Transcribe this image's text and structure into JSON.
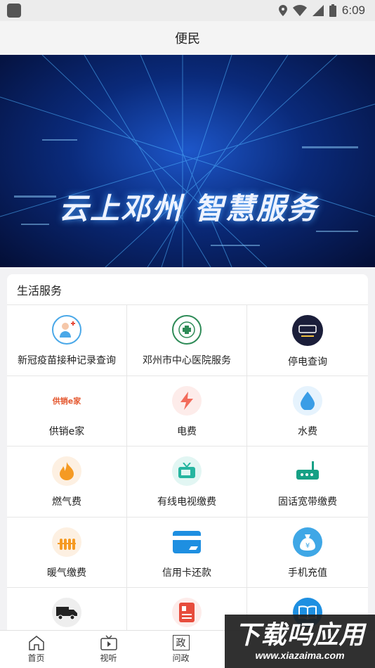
{
  "status_bar": {
    "time": "6:09"
  },
  "header": {
    "title": "便民"
  },
  "banner": {
    "text": "云上邓州 智慧服务"
  },
  "section": {
    "title": "生活服务",
    "items": [
      {
        "label": "新冠疫苗接种记录查询",
        "icon": "vaccine-doctor-icon"
      },
      {
        "label": "邓州市中心医院服务",
        "icon": "hospital-emblem-icon"
      },
      {
        "label": "停电查询",
        "icon": "power-outage-icon"
      },
      {
        "label": "供销e家",
        "icon": "gongxiao-logo-icon",
        "icon_text": "供销e家"
      },
      {
        "label": "电费",
        "icon": "lightning-icon"
      },
      {
        "label": "水费",
        "icon": "water-drop-icon"
      },
      {
        "label": "燃气费",
        "icon": "flame-icon"
      },
      {
        "label": "有线电视缴费",
        "icon": "tv-icon"
      },
      {
        "label": "固话宽带缴费",
        "icon": "router-icon"
      },
      {
        "label": "暖气缴费",
        "icon": "heater-icon"
      },
      {
        "label": "信用卡还款",
        "icon": "credit-card-icon"
      },
      {
        "label": "手机充值",
        "icon": "money-bag-icon"
      },
      {
        "label": "",
        "icon": "truck-icon"
      },
      {
        "label": "",
        "icon": "id-card-icon"
      },
      {
        "label": "",
        "icon": "book-icon"
      }
    ]
  },
  "tabbar": {
    "items": [
      {
        "label": "首页",
        "icon": "home-icon"
      },
      {
        "label": "视听",
        "icon": "tv-play-icon"
      },
      {
        "label": "问政",
        "icon": "zheng-icon",
        "icon_text": "政"
      }
    ]
  },
  "watermark": {
    "title": "下载吗应用",
    "url": "www.xiazaima.com"
  },
  "colors": {
    "banner_dark": "#040e35",
    "banner_blue": "#1d56c9",
    "divider": "#e6e6e6",
    "background": "#f2f2f4"
  }
}
